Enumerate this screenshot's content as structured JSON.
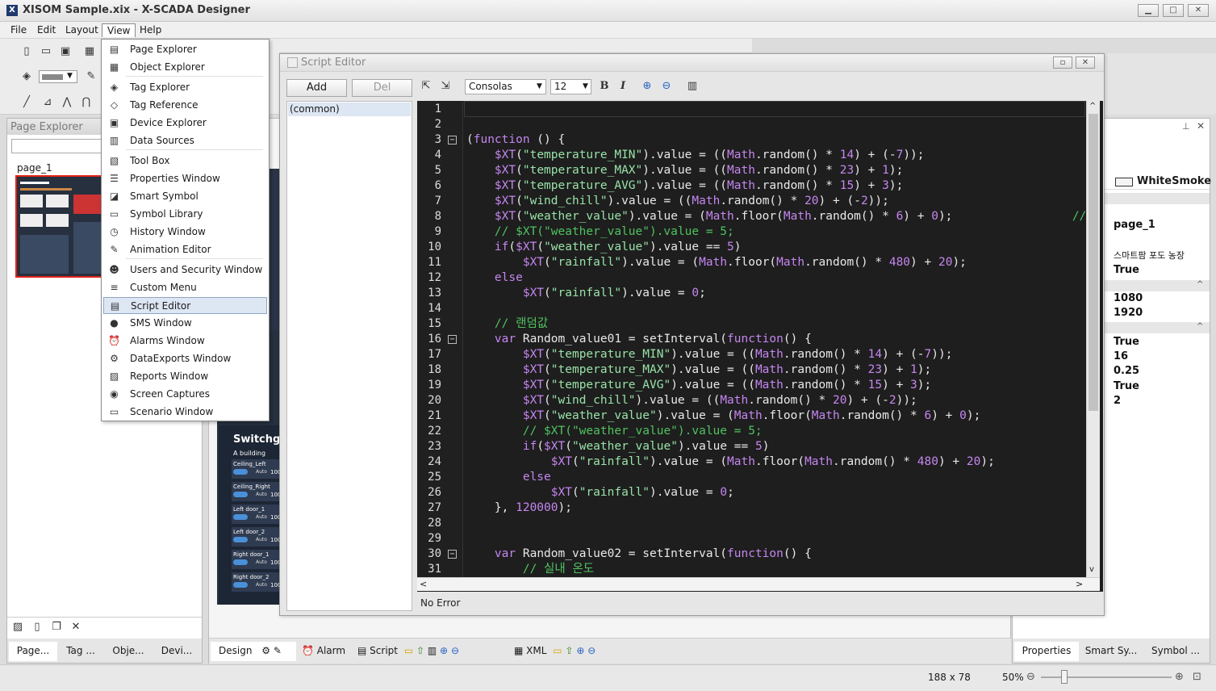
{
  "window": {
    "title": "XISOM Sample.xix - X-SCADA Designer",
    "logo": "X"
  },
  "menu": [
    "File",
    "Edit",
    "Layout",
    "View",
    "Help"
  ],
  "view_menu": [
    {
      "label": "Page Explorer",
      "icon": "page-explorer-icon",
      "glyph": "▤"
    },
    {
      "label": "Object Explorer",
      "icon": "object-explorer-icon",
      "glyph": "▦"
    },
    {
      "label": "Tag Explorer",
      "icon": "tag-explorer-icon",
      "glyph": "◈"
    },
    {
      "label": "Tag Reference",
      "icon": "tag-reference-icon",
      "glyph": "◇"
    },
    {
      "label": "Device Explorer",
      "icon": "device-explorer-icon",
      "glyph": "▣"
    },
    {
      "label": "Data Sources",
      "icon": "data-sources-icon",
      "glyph": "▥"
    },
    {
      "label": "Tool Box",
      "icon": "toolbox-icon",
      "glyph": "▧"
    },
    {
      "label": "Properties Window",
      "icon": "properties-icon",
      "glyph": "☰"
    },
    {
      "label": "Smart Symbol",
      "icon": "smart-symbol-icon",
      "glyph": "◪"
    },
    {
      "label": "Symbol Library",
      "icon": "symbol-library-icon",
      "glyph": "▭"
    },
    {
      "label": "History Window",
      "icon": "history-icon",
      "glyph": "◷"
    },
    {
      "label": "Animation Editor",
      "icon": "animation-icon",
      "glyph": "✎"
    },
    {
      "label": "Users and Security Window",
      "icon": "users-icon",
      "glyph": "☻"
    },
    {
      "label": "Custom Menu",
      "icon": "custom-menu-icon",
      "glyph": "≡"
    },
    {
      "label": "Script Editor",
      "icon": "script-editor-icon",
      "glyph": "▤"
    },
    {
      "label": "SMS Window",
      "icon": "sms-icon",
      "glyph": "●"
    },
    {
      "label": "Alarms Window",
      "icon": "alarm-icon",
      "glyph": "⏰"
    },
    {
      "label": "DataExports Window",
      "icon": "data-export-icon",
      "glyph": "⚙"
    },
    {
      "label": "Reports Window",
      "icon": "reports-icon",
      "glyph": "▨"
    },
    {
      "label": "Screen Captures",
      "icon": "camera-icon",
      "glyph": "◉"
    },
    {
      "label": "Scenario Window",
      "icon": "scenario-icon",
      "glyph": "▭"
    }
  ],
  "page_explorer": {
    "title": "Page Explorer",
    "page": "page_1",
    "tabs": [
      "Page...",
      "Tag ...",
      "Obje...",
      "Devi..."
    ]
  },
  "script_editor": {
    "title": "Script Editor",
    "add": "Add",
    "del": "Del",
    "font": "Consolas",
    "size": "12",
    "bold": "B",
    "italic": "I",
    "scripts": [
      "(common)"
    ],
    "status": "No Error"
  },
  "preview": {
    "panel_title": "Switchge",
    "building": "A building",
    "rows": [
      "Ceiling_Left",
      "Ceiling_Right",
      "Left door_1",
      "Left door_2",
      "Right door_1",
      "Right door_2"
    ],
    "auto": "Auto",
    "value": "100"
  },
  "bottom_tabs": {
    "design": "Design",
    "alarm": "Alarm",
    "script": "Script",
    "xml": "XML"
  },
  "properties": {
    "color_name": "WhiteSmoke",
    "values": [
      "page_1",
      "스마트팜 포도 농장",
      "True",
      "1080",
      "1920",
      "True",
      "16",
      "0.25",
      "True",
      "2"
    ],
    "tabs": [
      "Properties",
      "Smart Sy...",
      "Symbol ..."
    ]
  },
  "status": {
    "size": "188 x 78",
    "zoom": "50%"
  },
  "code_lines": [
    "",
    "",
    "<span class='fn'>(</span><span class='k'>function</span> () {",
    "    <span class='k'>$XT</span>(<span class='s'>\"temperature_MIN\"</span>).value = ((<span class='k'>Math</span>.random() * <span class='n'>14</span>) + (-<span class='n'>7</span>));",
    "    <span class='k'>$XT</span>(<span class='s'>\"temperature_MAX\"</span>).value = ((<span class='k'>Math</span>.random() * <span class='n'>23</span>) + <span class='n'>1</span>);",
    "    <span class='k'>$XT</span>(<span class='s'>\"temperature_AVG\"</span>).value = ((<span class='k'>Math</span>.random() * <span class='n'>15</span>) + <span class='n'>3</span>);",
    "    <span class='k'>$XT</span>(<span class='s'>\"wind_chill\"</span>).value = ((<span class='k'>Math</span>.random() * <span class='n'>20</span>) + (-<span class='n'>2</span>));",
    "    <span class='k'>$XT</span>(<span class='s'>\"weather_value\"</span>).value = (<span class='k'>Math</span>.floor(<span class='k'>Math</span>.random() * <span class='n'>6</span>) + <span class='n'>0</span>);                 <span class='c'>//</span>",
    "    <span class='c'>// $XT(\"weather_value\").value = 5;</span>",
    "    <span class='k'>if</span>(<span class='k'>$XT</span>(<span class='s'>\"weather_value\"</span>).value == <span class='n'>5</span>)",
    "        <span class='k'>$XT</span>(<span class='s'>\"rainfall\"</span>).value = (<span class='k'>Math</span>.floor(<span class='k'>Math</span>.random() * <span class='n'>480</span>) + <span class='n'>20</span>);",
    "    <span class='k'>else</span>",
    "        <span class='k'>$XT</span>(<span class='s'>\"rainfall\"</span>).value = <span class='n'>0</span>;",
    "",
    "    <span class='c'>// 랜덤값</span>",
    "    <span class='k'>var</span> Random_value01 = setInterval(<span class='k'>function</span>() {",
    "        <span class='k'>$XT</span>(<span class='s'>\"temperature_MIN\"</span>).value = ((<span class='k'>Math</span>.random() * <span class='n'>14</span>) + (-<span class='n'>7</span>));",
    "        <span class='k'>$XT</span>(<span class='s'>\"temperature_MAX\"</span>).value = ((<span class='k'>Math</span>.random() * <span class='n'>23</span>) + <span class='n'>1</span>);",
    "        <span class='k'>$XT</span>(<span class='s'>\"temperature_AVG\"</span>).value = ((<span class='k'>Math</span>.random() * <span class='n'>15</span>) + <span class='n'>3</span>);",
    "        <span class='k'>$XT</span>(<span class='s'>\"wind_chill\"</span>).value = ((<span class='k'>Math</span>.random() * <span class='n'>20</span>) + (-<span class='n'>2</span>));",
    "        <span class='k'>$XT</span>(<span class='s'>\"weather_value\"</span>).value = (<span class='k'>Math</span>.floor(<span class='k'>Math</span>.random() * <span class='n'>6</span>) + <span class='n'>0</span>);",
    "        <span class='c'>// $XT(\"weather_value\").value = 5;</span>",
    "        <span class='k'>if</span>(<span class='k'>$XT</span>(<span class='s'>\"weather_value\"</span>).value == <span class='n'>5</span>)",
    "            <span class='k'>$XT</span>(<span class='s'>\"rainfall\"</span>).value = (<span class='k'>Math</span>.floor(<span class='k'>Math</span>.random() * <span class='n'>480</span>) + <span class='n'>20</span>);",
    "        <span class='k'>else</span>",
    "            <span class='k'>$XT</span>(<span class='s'>\"rainfall\"</span>).value = <span class='n'>0</span>;",
    "    }, <span class='n'>120000</span>);",
    "",
    "",
    "    <span class='k'>var</span> Random_value02 = setInterval(<span class='k'>function</span>() {",
    "        <span class='c'>// 실내 온도</span>"
  ]
}
